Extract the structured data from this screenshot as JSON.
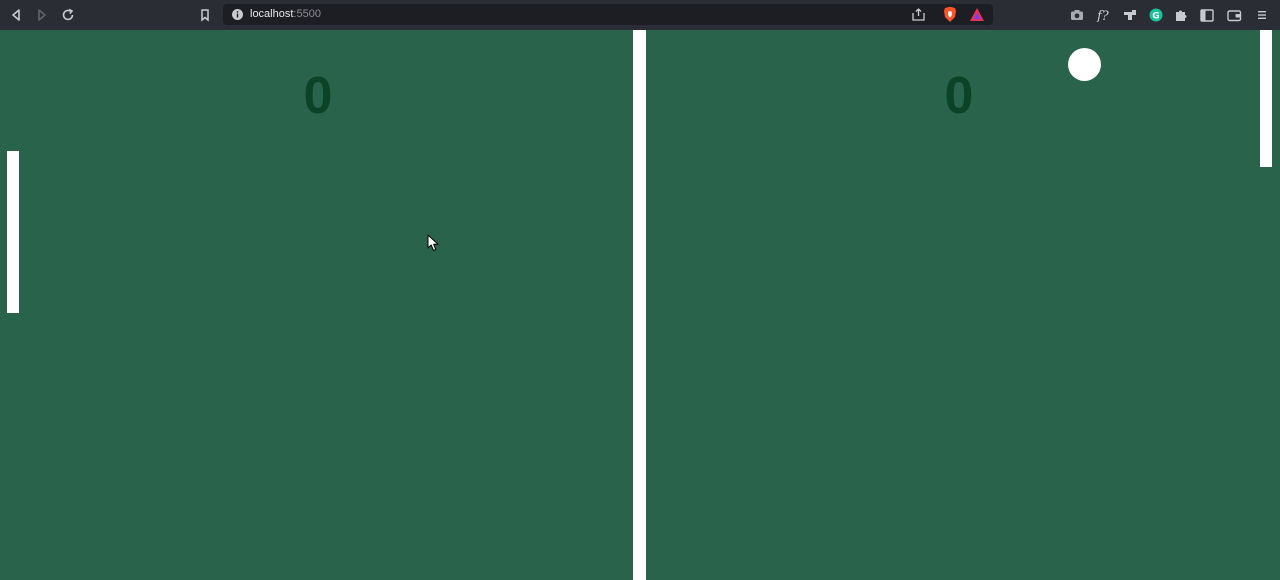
{
  "browser": {
    "url_host": "localhost",
    "url_port": ":5500",
    "icons": [
      "back-icon",
      "forward-icon",
      "reload-icon",
      "bookmark-icon",
      "site-info-icon",
      "share-icon",
      "brave-shields-icon",
      "brave-rewards-icon",
      "screenshot-icon",
      "formula-extension-icon",
      "extension-icon",
      "grammarly-icon",
      "extensions-puzzle-icon",
      "sidebar-icon",
      "wallet-icon",
      "menu-icon"
    ]
  },
  "game": {
    "score_left": "0",
    "score_right": "0",
    "colors": {
      "field": "#2a634b",
      "score": "#0c4326",
      "paddle": "#ffffff",
      "ball": "#ffffff",
      "net": "#ffffff"
    }
  }
}
